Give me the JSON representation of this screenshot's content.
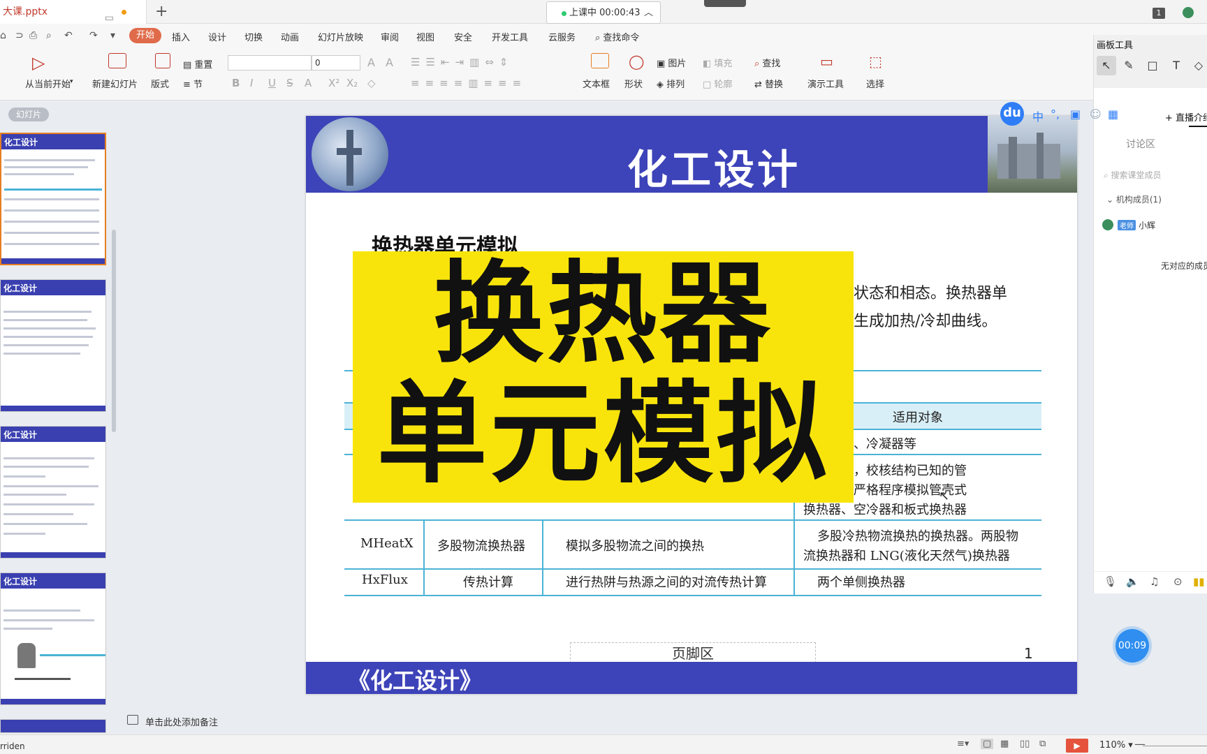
{
  "titlebar": {
    "filename": "大课.pptx",
    "live_label": "上课中 00:00:43",
    "window_badge": "1"
  },
  "menu": {
    "start": "开始",
    "items": [
      "插入",
      "设计",
      "切换",
      "动画",
      "幻灯片放映",
      "审阅",
      "视图",
      "安全",
      "开发工具",
      "云服务"
    ],
    "search": "查找命令"
  },
  "ribbon": {
    "from_current": "从当前开始",
    "new_slide": "新建幻灯片",
    "layout": "版式",
    "reset": "重置",
    "section": "节",
    "font_size": "0",
    "textbox": "文本框",
    "shape": "形状",
    "picture": "图片",
    "arrange": "排列",
    "fill": "填充",
    "outline": "轮廓",
    "find": "查找",
    "replace": "替换",
    "present_tools": "演示工具",
    "select": "选择",
    "bold": "B",
    "italic": "I",
    "underline": "U",
    "strike": "S"
  },
  "left_panel": {
    "tab_label": "幻灯片",
    "thumb_title": "化工设计"
  },
  "slide": {
    "title": "化工设计",
    "subtitle": "换热器单元模拟",
    "body_line1": "状态和相态。换热器单",
    "body_line2": "生成加热/冷却曲线。",
    "footer_title": "《化工设计》",
    "footer_area": "页脚区",
    "page_number": "1",
    "table": {
      "header_right": "适用对象",
      "row1_right": "、冷却器、冷凝器等",
      "row2_right_1": "流换热器，校核结构已知的管",
      "row2_right_2": "器，采用严格程序模拟管壳式",
      "row2_right_3": "换热器、空冷器和板式换热器",
      "row3": [
        "MHeatX",
        "多股物流换热器",
        "模拟多股物流之间的换热",
        "多股冷热物流换热的换热器。两股物",
        "流换热器和 LNG(液化天然气)换热器"
      ],
      "row4": [
        "HxFlux",
        "传热计算",
        "进行热阱与热源之间的对流传热计算",
        "两个单侧换热器"
      ]
    }
  },
  "overlay": {
    "line1": "换热器",
    "line2": "单元模拟"
  },
  "right_panel": {
    "board_tools": "画板工具",
    "live_intro": "+ 直播介绍",
    "discuss_tab": "讨论区",
    "search_placeholder": "搜索课堂成员",
    "org_members": "机构成员(1)",
    "teacher_badge": "老师",
    "member_name": "小辉",
    "no_member": "无对应的成员",
    "timer": "00:09",
    "du": "du",
    "zhong": "中"
  },
  "notes": {
    "placeholder": "单击此处添加备注"
  },
  "status": {
    "left": "rriden",
    "zoom": "110%"
  }
}
